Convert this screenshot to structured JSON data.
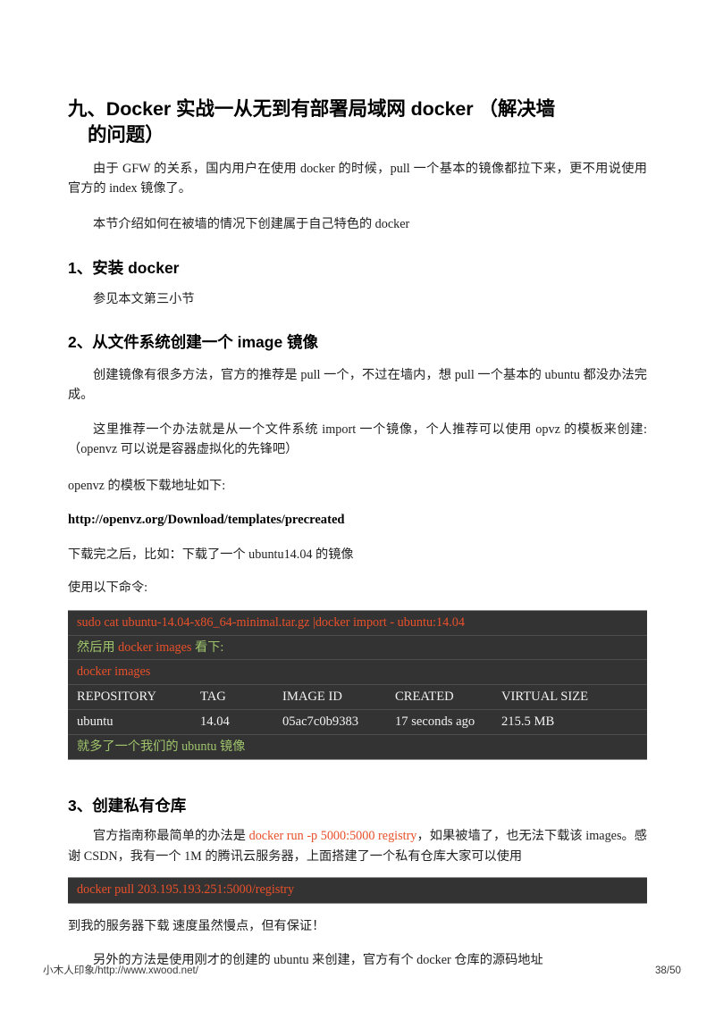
{
  "document": {
    "title_line1": "九、Docker 实战一从无到有部署局域网 docker （解决墙",
    "title_line2": "的问题）",
    "intro_paragraph": "由于 GFW 的关系，国内用户在使用 docker 的时候，pull 一个基本的镜像都拉下来，更不用说使用官方的 index 镜像了。",
    "intro_paragraph2": "本节介绍如何在被墙的情况下创建属于自己特色的 docker"
  },
  "section1": {
    "heading": "1、安装 docker",
    "body": "参见本文第三小节"
  },
  "section2": {
    "heading": "2、从文件系统创建一个 image 镜像",
    "para1": "创建镜像有很多方法，官方的推荐是 pull 一个，不过在墙内，想 pull 一个基本的 ubuntu 都没办法完成。",
    "para2": "这里推荐一个办法就是从一个文件系统 import 一个镜像，个人推荐可以使用 opvz 的模板来创建:（openvz 可以说是容器虚拟化的先锋吧）",
    "para3": "openvz 的模板下载地址如下:",
    "link": "http://openvz.org/Download/templates/precreated",
    "para4": "下载完之后，比如：下载了一个 ubuntu14.04 的镜像",
    "para5": "使用以下命令:"
  },
  "codeblock": {
    "line1": "sudo cat ubuntu-14.04-x86_64-minimal.tar.gz  |docker import - ubuntu:14.04",
    "line2_pre": "然后用 ",
    "line2_cmd": "docker images",
    "line2_post": " 看下:",
    "line3": "docker images",
    "table": {
      "headers": [
        "REPOSITORY",
        "TAG",
        "IMAGE ID",
        "CREATED",
        "VIRTUAL SIZE"
      ],
      "row": [
        "ubuntu",
        "14.04",
        "05ac7c0b9383",
        "17 seconds ago",
        "215.5 MB"
      ]
    },
    "line_note_pre": "就多了一个我们的 ",
    "line_note_cmd": "ubuntu",
    "line_note_post": " 镜像"
  },
  "section3": {
    "heading": "3、创建私有仓库",
    "para1_pre": "官方指南称最简单的办法是 ",
    "para1_code": "docker run -p 5000:5000 registry",
    "para1_post": "，如果被墙了，也无法下载该 images。感谢 CSDN，我有一个 1M 的腾讯云服务器，上面搭建了一个私有仓库大家可以使用",
    "pull_command": "docker pull 203.195.193.251:5000/registry",
    "para2": "到我的服务器下载 速度虽然慢点，但有保证！",
    "para3": "另外的方法是使用刚才的创建的 ubuntu 来创建，官方有个 docker 仓库的源码地址"
  },
  "footer": {
    "left": "小木人印象/http://www.xwood.net/",
    "right": "38/50"
  },
  "colors": {
    "code_background": "#333333",
    "code_red": "#e8502a",
    "code_green": "#9fc46b",
    "code_white": "#f2f2f2"
  }
}
